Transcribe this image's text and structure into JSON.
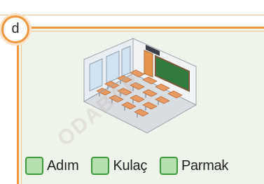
{
  "question": {
    "letter": "d",
    "illustration_icon": "classroom-illustration",
    "watermark_text": "ODABAR"
  },
  "options": [
    {
      "label": "Adım",
      "checked": false
    },
    {
      "label": "Kulaç",
      "checked": false
    },
    {
      "label": "Parmak",
      "checked": false
    }
  ],
  "colors": {
    "frame": "#f0973e",
    "panel_background": "#eef4ea",
    "checkbox_border": "#3e9a3e",
    "checkbox_fill": "#b6dfae"
  }
}
